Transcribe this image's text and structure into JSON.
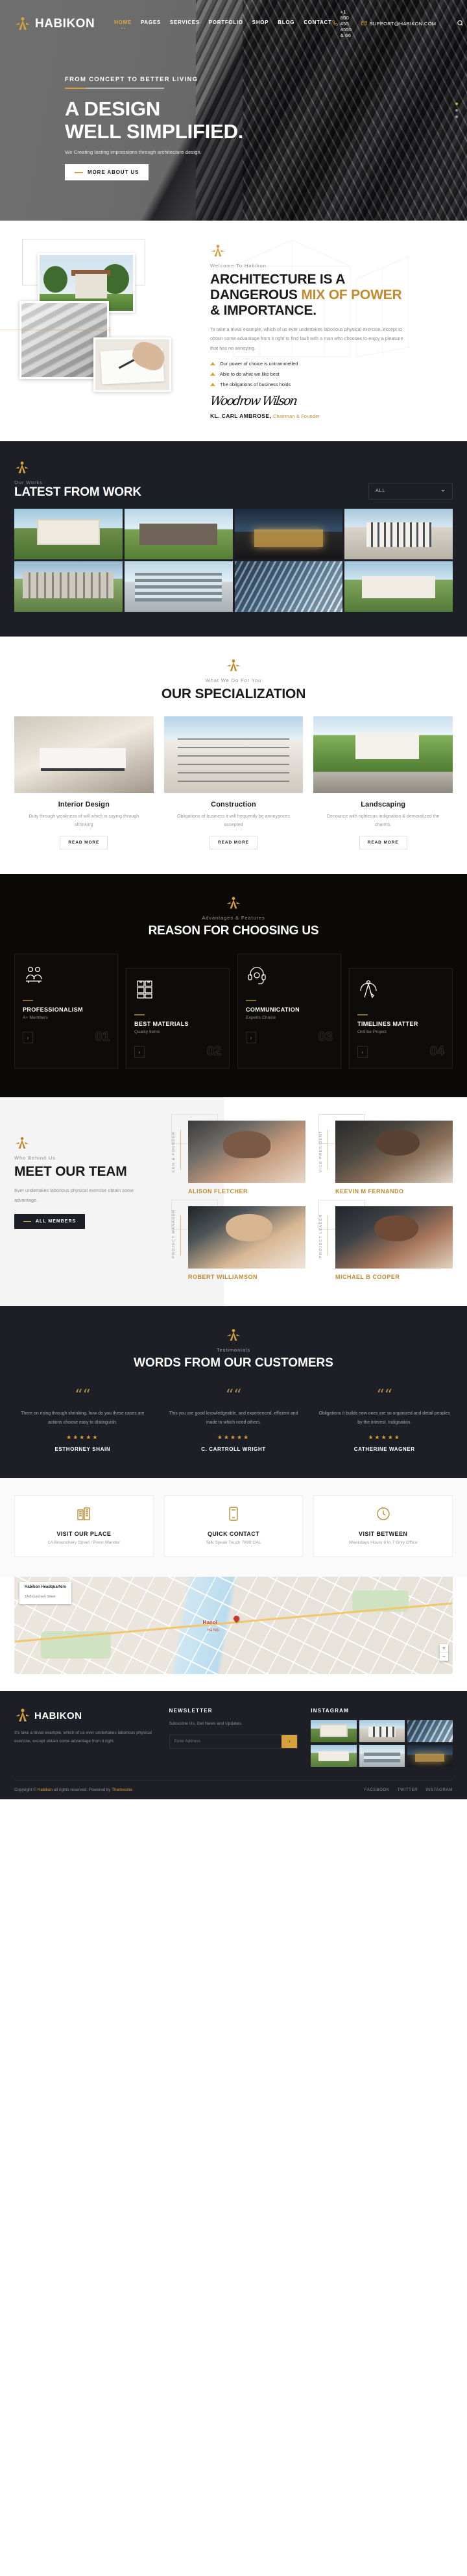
{
  "brand": {
    "name": "HABIKON",
    "accent": "#d4a13c",
    "dark": "#1d1e26"
  },
  "header": {
    "nav": [
      {
        "label": "HOME",
        "active": true
      },
      {
        "label": "PAGES",
        "active": false
      },
      {
        "label": "SERVICES",
        "active": false
      },
      {
        "label": "PORTFOLIO",
        "active": false
      },
      {
        "label": "SHOP",
        "active": false
      },
      {
        "label": "BLOG",
        "active": false
      },
      {
        "label": "CONTACT",
        "active": false
      }
    ],
    "phone": "+1 800 455 4555 & 66",
    "email": "SUPPORT@HABIKON.COM",
    "search_label": "search-icon"
  },
  "hero": {
    "eyebrow": "FROM CONCEPT TO BETTER LIVING",
    "title_line1": "A DESIGN",
    "title_line2": "WELL SIMPLIFIED.",
    "desc": "We Creating lasting impressions through architecture design.",
    "cta": "MORE ABOUT US"
  },
  "about": {
    "eyebrow": "Welcome To Habikon",
    "title_a": "ARCHITECTURE IS A",
    "title_b": "DANGEROUS ",
    "title_b_accent": "MIX OF POWER",
    "title_c": "& IMPORTANCE.",
    "body": "To take a trivial example, which of us ever undertakes laborious physical exercise, except to obtain some advantage from it right to find fault with a man who chooses to enjoy a pleasure that has no annoying.",
    "list": [
      "Our power of choice is untrammelled",
      "Able to do what we like best",
      "The obligations of business holds"
    ],
    "signature": "Woodrow Wilson",
    "sign_name": "KL. CARL AMBROSE,",
    "sign_role": "Chairman & Founder"
  },
  "works": {
    "eyebrow": "Our Works",
    "title": "LATEST FROM WORK",
    "filter_value": "ALL",
    "items": [
      {
        "name": "project-suburban-house",
        "img": "im-house1"
      },
      {
        "name": "project-modern-villa",
        "img": "im-house2"
      },
      {
        "name": "project-night-residence",
        "img": "im-night"
      },
      {
        "name": "project-modern-facade",
        "img": "im-modern"
      },
      {
        "name": "project-urban-block",
        "img": "im-urban"
      },
      {
        "name": "project-office-complex",
        "img": "im-office"
      },
      {
        "name": "project-glass-tower",
        "img": "im-glass"
      },
      {
        "name": "project-white-villa",
        "img": "im-villa"
      }
    ]
  },
  "spec": {
    "eyebrow": "What We Do For You",
    "title": "OUR SPECIALIZATION",
    "cards": [
      {
        "name": "Interior Design",
        "desc": "Duty through weakness of will which is saying through shrinking",
        "cta": "READ MORE",
        "img": "im-int1"
      },
      {
        "name": "Construction",
        "desc": "Obligations of business it will frequently be annoyances accepted",
        "cta": "READ MORE",
        "img": "im-constr"
      },
      {
        "name": "Landscaping",
        "desc": "Denounce with righteous indignation & demoralized the charms.",
        "cta": "READ MORE",
        "img": "im-land"
      }
    ]
  },
  "reason": {
    "eyebrow": "Advantages & Features",
    "title": "REASON FOR CHOOSING US",
    "cards": [
      {
        "title": "PROFESSIONALISM",
        "sub": "A+ Members",
        "num": "01",
        "icon": "team-icon"
      },
      {
        "title": "BEST MATERIALS",
        "sub": "Quality Items",
        "num": "02",
        "icon": "boxes-icon"
      },
      {
        "title": "COMMUNICATION",
        "sub": "Experts Choice",
        "num": "03",
        "icon": "headset-icon"
      },
      {
        "title": "TIMELINES MATTER",
        "sub": "Ontime Project",
        "num": "04",
        "icon": "compass-icon"
      }
    ]
  },
  "team": {
    "eyebrow": "Who Behind Us",
    "title": "MEET OUR TEAM",
    "desc": "Ever undertakes laborious physical exercise obtain some advantage.",
    "cta": "ALL MEMBERS",
    "members": [
      {
        "name": "ALISON FLETCHER",
        "role": "CEO & FOUNDER",
        "img": "p1"
      },
      {
        "name": "KEEVIN M FERNANDO",
        "role": "VICE PRESIDENT",
        "img": "p2"
      },
      {
        "name": "ROBERT WILLIAMSON",
        "role": "PROJECT MANAGER",
        "img": "p3"
      },
      {
        "name": "MICHAEL B COOPER",
        "role": "PROJECT LEADER",
        "img": "p4"
      }
    ]
  },
  "testimonials": {
    "eyebrow": "Testimonials",
    "title": "WORDS FROM OUR CUSTOMERS",
    "items": [
      {
        "text": "There on rising through shrinking, how do you these cases are actions choose easy to distinguish.",
        "stars": "★★★★★",
        "name": "ESTHORNEY SHAIN"
      },
      {
        "text": "This you are good knowledgeable, and experienced, efficient and made to which need others.",
        "stars": "★★★★★",
        "name": "C. CARTROLL WRIGHT"
      },
      {
        "text": "Obligations it builds new ones are so organized and detail peoples by the interest. Indignation.",
        "stars": "★★★★★",
        "name": "CATHERINE WAGNER"
      }
    ]
  },
  "info": {
    "boxes": [
      {
        "title": "VISIT OUR PLACE",
        "sub": "1A Brounchery Street / Penn Wander",
        "icon": "building-icon"
      },
      {
        "title": "QUICK CONTACT",
        "sub": "Talk Speak Touch 7899 CAL",
        "icon": "phone-box-icon"
      },
      {
        "title": "VISIT BETWEEN",
        "sub": "Weekdays Hours 9 to 7 Only Office",
        "icon": "clock-icon"
      }
    ]
  },
  "map": {
    "card_title": "Habikon Headquarters",
    "card_sub": "1A Brounchery Street",
    "label": "Hanoi",
    "label2": "Hà Nội",
    "zoom_in": "+",
    "zoom_out": "−"
  },
  "footer": {
    "about_desc": "It's take a trivial example, which of us ever undertakes laborious physical exercise, except obtain some advantage from it right.",
    "newsletter_title": "NEWSLETTER",
    "newsletter_sub": "Subscribe Us, Get News and Updates.",
    "newsletter_placeholder": "Enter Address",
    "newsletter_btn": "›",
    "instagram_title": "INSTAGRAM",
    "copy_pre": "Copyright © ",
    "copy_brand": "Habikon",
    "copy_post": " all rights reserved. Powered by ",
    "copy_brand2": "Themesine",
    "copy_end": ".",
    "links": [
      {
        "label": "FACEBOOK"
      },
      {
        "label": "TWITTER"
      },
      {
        "label": "INSTAGRAM"
      }
    ]
  }
}
